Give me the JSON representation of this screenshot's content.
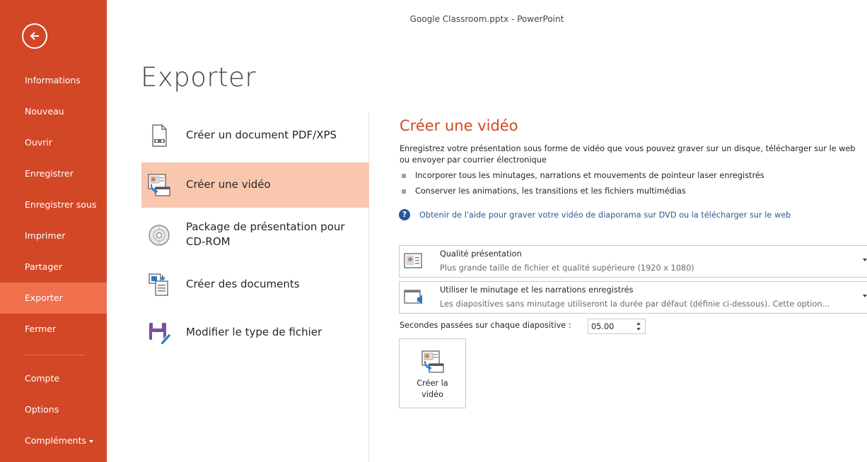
{
  "window": {
    "title": "Google Classroom.pptx - PowerPoint"
  },
  "sidebar": {
    "items": [
      {
        "label": "Informations"
      },
      {
        "label": "Nouveau"
      },
      {
        "label": "Ouvrir"
      },
      {
        "label": "Enregistrer"
      },
      {
        "label": "Enregistrer sous"
      },
      {
        "label": "Imprimer"
      },
      {
        "label": "Partager"
      },
      {
        "label": "Exporter"
      },
      {
        "label": "Fermer"
      },
      {
        "label": "Compte"
      },
      {
        "label": "Options"
      },
      {
        "label": "Compléments"
      }
    ],
    "active": "Exporter"
  },
  "page": {
    "title": "Exporter"
  },
  "export_options": [
    {
      "label": "Créer un document PDF/XPS",
      "icon": "pdf-document-icon"
    },
    {
      "label": "Créer une vidéo",
      "icon": "video-icon"
    },
    {
      "label": "Package de présentation pour CD-ROM",
      "icon": "cd-icon"
    },
    {
      "label": "Créer des documents",
      "icon": "handouts-icon"
    },
    {
      "label": "Modifier le type de fichier",
      "icon": "save-as-icon"
    }
  ],
  "video_panel": {
    "title": "Créer une vidéo",
    "description": "Enregistrez votre présentation sous forme de vidéo que vous pouvez graver sur un disque, télécharger sur le web ou envoyer par courrier électronique",
    "bullets": [
      "Incorporer tous les minutages, narrations et mouvements de pointeur laser enregistrés",
      "Conserver les animations, les transitions et les fichiers multimédias"
    ],
    "help_link": "Obtenir de l'aide pour graver votre vidéo de diaporama sur DVD ou la télécharger sur le web",
    "quality": {
      "title": "Qualité présentation",
      "subtitle": "Plus grande taille de fichier et qualité supérieure (1920 x 1080)"
    },
    "timing": {
      "title": "Utiliser le minutage et les narrations enregistrés",
      "subtitle": "Les diapositives sans minutage utiliseront la durée par défaut (définie ci-dessous). Cette option..."
    },
    "seconds_label": "Secondes passées sur chaque diapositive :",
    "seconds_value": "05.00",
    "create_button": "Créer la\nvidéo"
  },
  "colors": {
    "accent": "#d24726",
    "active_nav": "#f0704d",
    "selected_option": "#f9c6ae",
    "link": "#2b579a"
  }
}
